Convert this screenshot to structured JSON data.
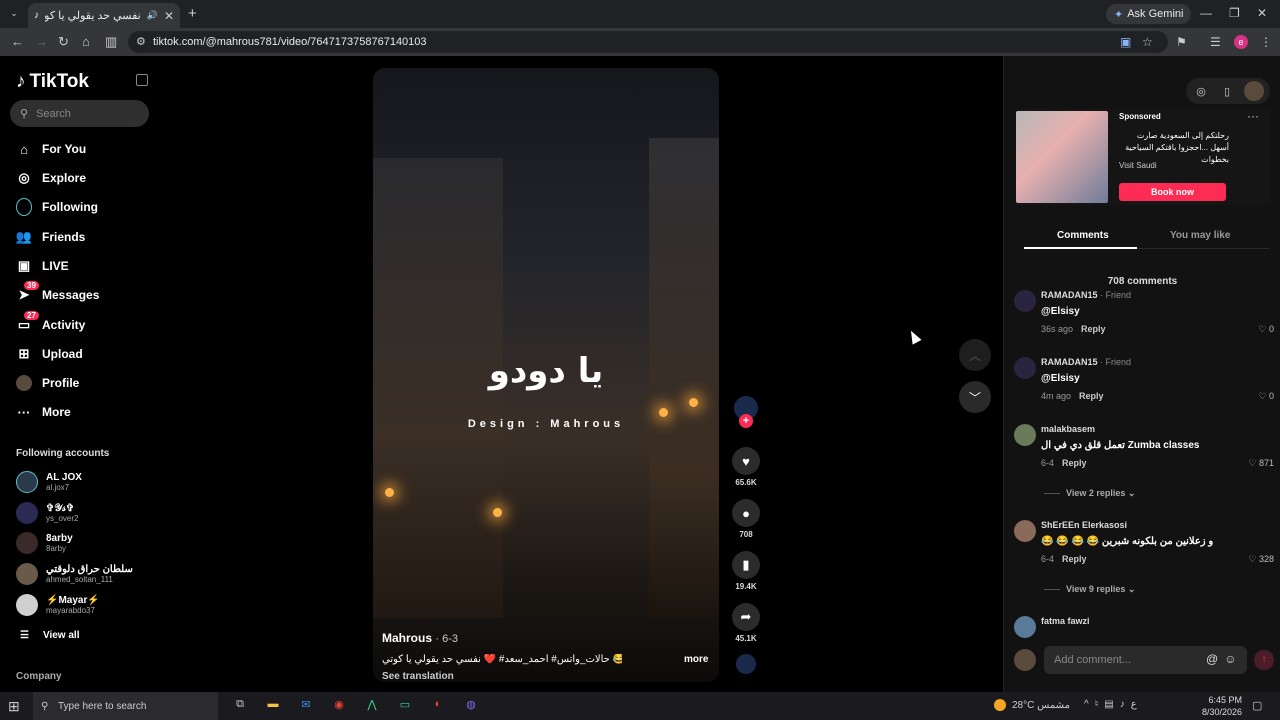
{
  "browser": {
    "tab_title": "نفسي حد يقولي يا كوتي — ...",
    "url": "tiktok.com/@mahrous781/video/7647173758767140103",
    "gemini_label": "Ask Gemini",
    "profile_letter": "e"
  },
  "sidebar": {
    "logo": "TikTok",
    "search_placeholder": "Search",
    "nav": [
      {
        "label": "For You",
        "icon": "home-icon"
      },
      {
        "label": "Explore",
        "icon": "compass-icon"
      },
      {
        "label": "Following",
        "icon": "following-icon"
      },
      {
        "label": "Friends",
        "icon": "friends-icon"
      },
      {
        "label": "LIVE",
        "icon": "live-icon"
      },
      {
        "label": "Messages",
        "icon": "messages-icon",
        "badge": "39"
      },
      {
        "label": "Activity",
        "icon": "activity-icon",
        "badge": "27"
      },
      {
        "label": "Upload",
        "icon": "upload-icon"
      },
      {
        "label": "Profile",
        "icon": "profile-icon"
      },
      {
        "label": "More",
        "icon": "more-icon"
      }
    ],
    "following_title": "Following accounts",
    "accounts": [
      {
        "name": "AL JOX",
        "id": "al.jox7"
      },
      {
        "name": "✞𝒴𝓈✞",
        "id": "ys_over2"
      },
      {
        "name": "8arby",
        "id": "8arby"
      },
      {
        "name": "سلطان حراق دلوقتي",
        "id": "ahmed_soltan_111"
      },
      {
        "name": "⚡Mayar⚡",
        "id": "mayarabdo37"
      }
    ],
    "view_all": "View all",
    "company": "Company"
  },
  "video": {
    "overlay_text": "يا دودو",
    "design_text": "Design : Mahrous",
    "author": "Mahrous",
    "date": "· 6-3",
    "caption": "حالات_واتس# احمد_سعد# ❤️ نفسي حد يقولي يا كوتي 😂 ...",
    "more": "more",
    "see_translation": "See translation",
    "progress": 0.18,
    "likes": "65.6K",
    "comments": "708",
    "saves": "19.4K",
    "shares": "45.1K"
  },
  "right_panel": {
    "ad": {
      "sponsored": "Sponsored",
      "text": "رحلتكم إلى السعودية صارت أسهل ...احجزوا باقتكم السياحية بخطوات",
      "brand": "Visit Saudi",
      "cta": "Book now"
    },
    "tabs": {
      "comments": "Comments",
      "may_like": "You may like"
    },
    "comment_count": "708 comments",
    "comments": [
      {
        "user": "RAMADAN15",
        "friend": "· Friend",
        "text": "@Elsisy",
        "time": "36s ago",
        "reply": "Reply",
        "likes": "0"
      },
      {
        "user": "RAMADAN15",
        "friend": "· Friend",
        "text": "@Elsisy",
        "time": "4m ago",
        "reply": "Reply",
        "likes": "0"
      },
      {
        "user": "malakbasem",
        "friend": "",
        "text": "تعمل قلق دي في ال Zumba classes",
        "time": "6-4",
        "reply": "Reply",
        "likes": "871"
      },
      {
        "user": "ShErEEn Elerkasosi",
        "friend": "",
        "text": "😂 😂 😂 😂 و زعلانين من بلكونه شبرين",
        "time": "6-4",
        "reply": "Reply",
        "likes": "328"
      },
      {
        "user": "fatma fawzi",
        "friend": "",
        "text": "",
        "time": "",
        "reply": "",
        "likes": ""
      }
    ],
    "view_replies": [
      "View 2 replies ⌄",
      "View 9 replies ⌄"
    ],
    "add_comment_placeholder": "Add comment..."
  },
  "taskbar": {
    "search_placeholder": "Type here to search",
    "weather": "28°C مشمس",
    "time": "6:45 PM",
    "date": "8/30/2026",
    "lang": "ع"
  }
}
